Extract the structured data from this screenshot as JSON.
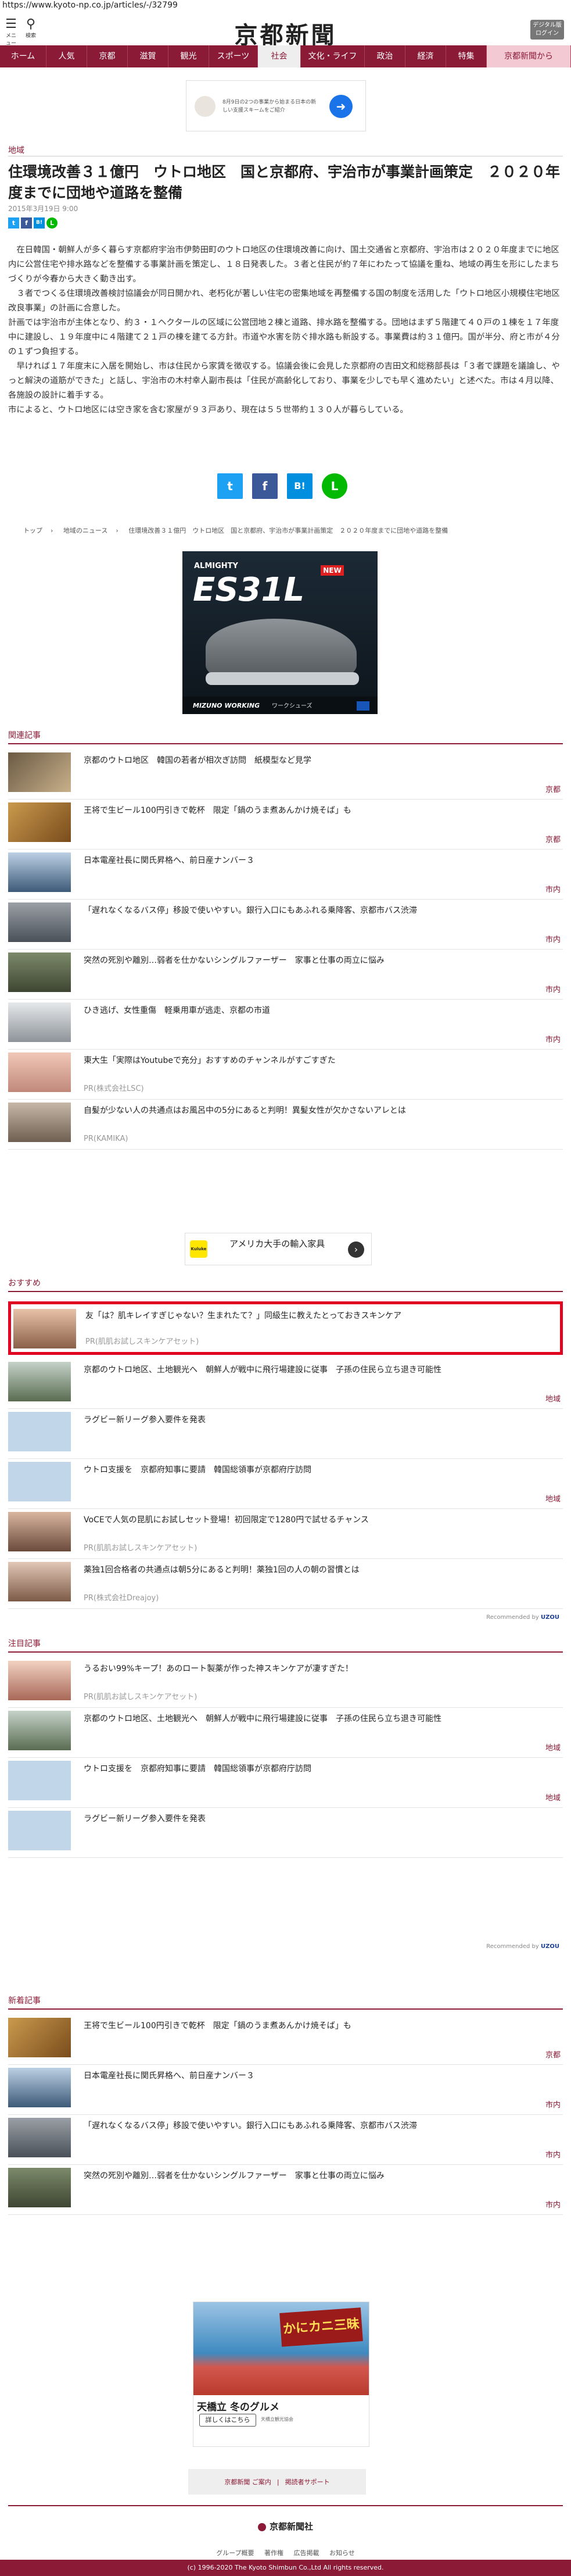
{
  "url": "https://www.kyoto-np.co.jp/articles/-/32799",
  "header": {
    "logo": "京都新聞",
    "menu_label": "メニュー",
    "search_label": "検索",
    "digital_label": "デジタル版ログイン"
  },
  "nav": [
    {
      "label": "ホーム"
    },
    {
      "label": "人気"
    },
    {
      "label": "京都"
    },
    {
      "label": "滋賀"
    },
    {
      "label": "観光"
    },
    {
      "label": "スポーツ"
    },
    {
      "label": "社会"
    },
    {
      "label": "文化・ライフ"
    },
    {
      "label": "政治"
    },
    {
      "label": "経済"
    },
    {
      "label": "特集"
    },
    {
      "label": "京都新聞から"
    }
  ],
  "ad_top": {
    "text": "8月9日の2つの事業から始まる日本の新しい支援スキームをご紹介"
  },
  "article": {
    "section": "地域",
    "title": "住環境改善３１億円　ウトロ地区　国と京都府、宇治市が事業計画策定　２０２０年度までに団地や道路を整備",
    "date": "2015年3月19日 9:00",
    "paragraphs": [
      "　在日韓国・朝鮮人が多く暮らす京都府宇治市伊勢田町のウトロ地区の住環境改善に向け、国土交通省と京都府、宇治市は２０２０年度までに地区内に公営住宅や排水路などを整備する事業計画を策定し、１８日発表した。３者と住民が約７年にわたって協議を重ね、地域の再生を形にしたまちづくりが今春から大きく動き出す。",
      "　３者でつくる住環境改善検討協議会が同日開かれ、老朽化が著しい住宅の密集地域を再整備する国の制度を活用した「ウトロ地区小規模住宅地区改良事業」の計画に合意した。",
      "計画では宇治市が主体となり、約３・１ヘクタールの区域に公営団地２棟と道路、排水路を整備する。団地はまず５階建て４０戸の１棟を１７年度中に建設し、１９年度中に４階建て２１戸の棟を建てる方針。市道や水害を防ぐ排水路も新設する。事業費は約３１億円。国が半分、府と市が４分の１ずつ負担する。",
      "　早ければ１７年度末に入居を開始し、市は住民から家賃を徴収する。協議会後に会見した京都府の吉田文和総務部長は「３者で課題を議論し、やっと解決の道筋ができた」と話し、宇治市の木村幸人副市長は「住民が高齢化しており、事業を少しでも早く進めたい」と述べた。市は４月以降、各施設の設計に着手する。",
      "市によると、ウトロ地区には空き家を含む家屋が９３戸あり、現在は５５世帯約１３０人が暮らしている。"
    ]
  },
  "share_small": [
    "t",
    "f",
    "B!",
    "L"
  ],
  "share_big": [
    "t",
    "f",
    "B!",
    "L"
  ],
  "breadcrumb": [
    "トップ",
    "地域のニュース",
    "住環境改善３１億円　ウトロ地区　国と京都府、宇治市が事業計画策定　２０２０年度までに団地や道路を整備"
  ],
  "ad_shoe": {
    "brand": "ALMIGHTY",
    "model": "ES31L",
    "badge": "NEW",
    "tagline": "MIZUNO WORKING",
    "footer": "ワークシューズ"
  },
  "related": {
    "heading": "関連記事",
    "items": [
      {
        "title": "京都のウトロ地区　韓国の若者が相次ぎ訪問　紙模型など見学",
        "tag": "京都"
      },
      {
        "title": "王将で生ビール100円引きで乾杯　限定「鍋のうま煮あんかけ焼そば」も",
        "tag": "京都"
      },
      {
        "title": "日本電産社長に関氏昇格へ、前日産ナンバー３",
        "tag": "市内"
      },
      {
        "title": "「遅れなくなるバス停」移設で使いやすい。銀行入口にもあふれる乗降客、京都市バス渋滞",
        "tag": "市内"
      },
      {
        "title": "突然の死別や離別…弱者を仕かないシングルファーザー　家事と仕事の両立に悩み",
        "tag": "市内"
      },
      {
        "title": "ひき逃げ、女性重傷　軽乗用車が逃走、京都の市道",
        "tag": "市内"
      },
      {
        "title": "東大生「実際はYoutubeで充分」おすすめのチャンネルがすごすぎた",
        "pr": "PR(株式会社LSC)"
      },
      {
        "title": "自髪が少ない人の共通点はお風呂中の5分にあると判明！異髪女性が欠かさないアレとは",
        "pr": "PR(KAMIKA)"
      }
    ]
  },
  "ad_mid": {
    "text": "アメリカ大手の輸入家具",
    "logo": "Kuluke"
  },
  "recommend": {
    "heading": "おすすめ",
    "items": [
      {
        "title": "友「は？肌キレイすぎじゃない？生まれたて？」同級生に教えたとっておきスキンケア",
        "pr": "PR(肌肌お試しスキンケアセット)"
      },
      {
        "title": "京都のウトロ地区、土地観光へ　朝鮮人が戦中に飛行場建設に従事　子孫の住民ら立ち退き可能性",
        "tag": "地域"
      },
      {
        "title": "ラグビー新リーグ参入要件を発表",
        "tag": ""
      },
      {
        "title": "ウトロ支援を　京都府知事に要請　韓国総領事が京都府庁訪問",
        "tag": "地域"
      },
      {
        "title": "VoCEで人気の昆肌にお試しセット登場！初回限定で1280円で試せるチャンス",
        "pr": "PR(肌肌お試しスキンケアセット)"
      },
      {
        "title": "薬独1回合格者の共通点は朝5分にあると判明！薬独1回の人の朝の習慣とは",
        "pr": "PR(株式会社Dreajoy)"
      }
    ],
    "recommended_by": "Recommended by",
    "provider": "UZOU"
  },
  "attention": {
    "heading": "注目記事",
    "items": [
      {
        "title": "うるおい99%キープ！あのロート製薬が作った神スキンケアが凄すぎた！",
        "pr": "PR(肌肌お試しスキンケアセット)"
      },
      {
        "title": "京都のウトロ地区、土地観光へ　朝鮮人が戦中に飛行場建設に従事　子孫の住民ら立ち退き可能性",
        "tag": "地域"
      },
      {
        "title": "ウトロ支援を　京都府知事に要請　韓国総領事が京都府庁訪問",
        "tag": "地域"
      },
      {
        "title": "ラグビー新リーグ参入要件を発表",
        "tag": ""
      }
    ],
    "recommended_by": "Recommended by",
    "provider": "UZOU"
  },
  "latest": {
    "heading": "新着記事",
    "items": [
      {
        "title": "王将で生ビール100円引きで乾杯　限定「鍋のうま煮あんかけ焼そば」も",
        "tag": "京都"
      },
      {
        "title": "日本電産社長に関氏昇格へ、前日産ナンバー３",
        "tag": "市内"
      },
      {
        "title": "「遅れなくなるバス停」移設で使いやすい。銀行入口にもあふれる乗降客、京都市バス渋滞",
        "tag": "市内"
      },
      {
        "title": "突然の死別や離別…弱者を仕かないシングルファーザー　家事と仕事の両立に悩み",
        "tag": "市内"
      }
    ]
  },
  "ad_bottom": {
    "banner": "かにカニ三昧",
    "title": "天橋立 冬のグルメ",
    "button": "詳しくはこちら",
    "sponsor": "天橋立観光協会"
  },
  "footer": {
    "links_bar": [
      "京都新聞 ご案内",
      "掲読者サポート"
    ],
    "logo": "京都新聞社",
    "links": [
      "グループ概要",
      "著作権",
      "広告掲載",
      "お知らせ"
    ],
    "copyright": "(c) 1996-2020 The Kyoto Shimbun Co.,Ltd All rights reserved."
  },
  "colors": {
    "brand": "#8b1a36",
    "twitter": "#1da1f2",
    "facebook": "#3b5998",
    "hatena": "#008fde",
    "line": "#00b900",
    "highlight": "#e00020"
  }
}
